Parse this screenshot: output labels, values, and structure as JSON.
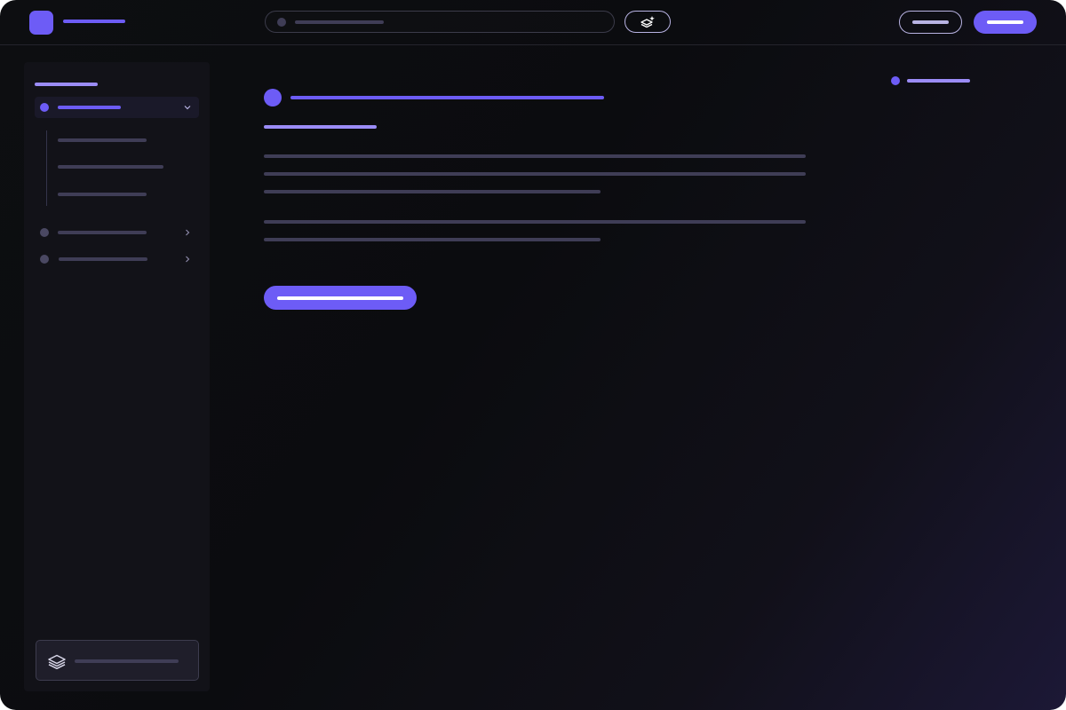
{
  "colors": {
    "accent": "#6d5cf6",
    "accent_light": "#9b8cf7",
    "skeleton": "#3f3d56",
    "skeleton_dim": "#4a4862",
    "white": "#ffffff"
  },
  "icons": {
    "ai": "sparkle-layers-icon",
    "footer": "layers-icon",
    "expand": "chevron-down-icon",
    "collapse": "chevron-right-icon"
  }
}
